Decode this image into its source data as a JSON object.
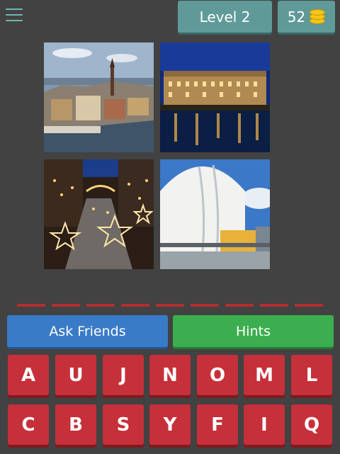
{
  "header": {
    "level_label": "Level 2",
    "coins": "52",
    "icons": {
      "menu": "hamburger-menu-icon",
      "coins": "coin-stack-icon"
    }
  },
  "images": [
    {
      "name": "old-town-waterfront-photo"
    },
    {
      "name": "palace-at-night-photo"
    },
    {
      "name": "christmas-street-lights-photo"
    },
    {
      "name": "white-dome-arena-photo"
    }
  ],
  "answer": {
    "length": 9
  },
  "actions": {
    "ask_friends": "Ask Friends",
    "hints": "Hints"
  },
  "keyboard": {
    "rows": [
      [
        "A",
        "U",
        "J",
        "N",
        "O",
        "M",
        "L"
      ],
      [
        "C",
        "B",
        "S",
        "Y",
        "F",
        "I",
        "Q"
      ]
    ]
  },
  "colors": {
    "background": "#424242",
    "header_button": "#5f9a98",
    "ask_friends": "#3a7bc8",
    "hints": "#3cae4f",
    "key": "#c6303a",
    "slot": "#b22f2f",
    "coin": "#f5c518"
  }
}
